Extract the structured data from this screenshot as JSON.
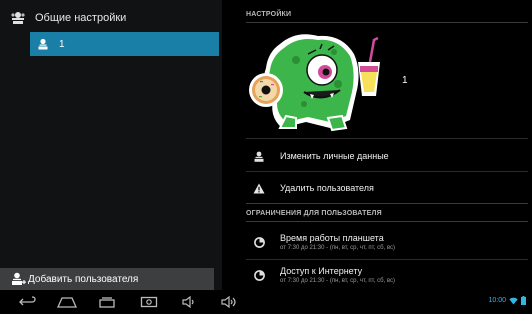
{
  "left_panel": {
    "header_label": "Общие настройки",
    "selected_user": "1",
    "add_user_label": "Добавить пользователя"
  },
  "right_panel": {
    "settings_title": "НАСТРОЙКИ",
    "profile_name": "1",
    "actions": {
      "edit_personal": "Изменить личные данные",
      "delete_user": "Удалить пользователя"
    },
    "restrictions_title": "ОГРАНИЧЕНИЯ ДЛЯ ПОЛЬЗОВАТЕЛЯ",
    "restrictions": [
      {
        "title": "Время работы планшета",
        "subtitle": "от 7:30 до 21:30 - (пн, вт, ср, чт, пт, сб, вс)"
      },
      {
        "title": "Доступ к Интернету",
        "subtitle": "от 7:30 до 21:30 - (пн, вт, ср, чт, пт, сб, вс)"
      }
    ]
  },
  "status_bar": {
    "time": "10:00",
    "accent_color": "#33b5e5"
  },
  "icons": {
    "header": "users-settings-icon",
    "user": "user-icon",
    "add_user": "add-user-icon",
    "edit": "edit-user-icon",
    "delete": "warning-icon",
    "clock": "clock-icon",
    "nav": [
      "back-icon",
      "home-icon",
      "recents-icon",
      "screenshot-icon",
      "volume-down-icon",
      "volume-up-icon"
    ],
    "wifi": "wifi-icon",
    "battery": "battery-icon"
  }
}
